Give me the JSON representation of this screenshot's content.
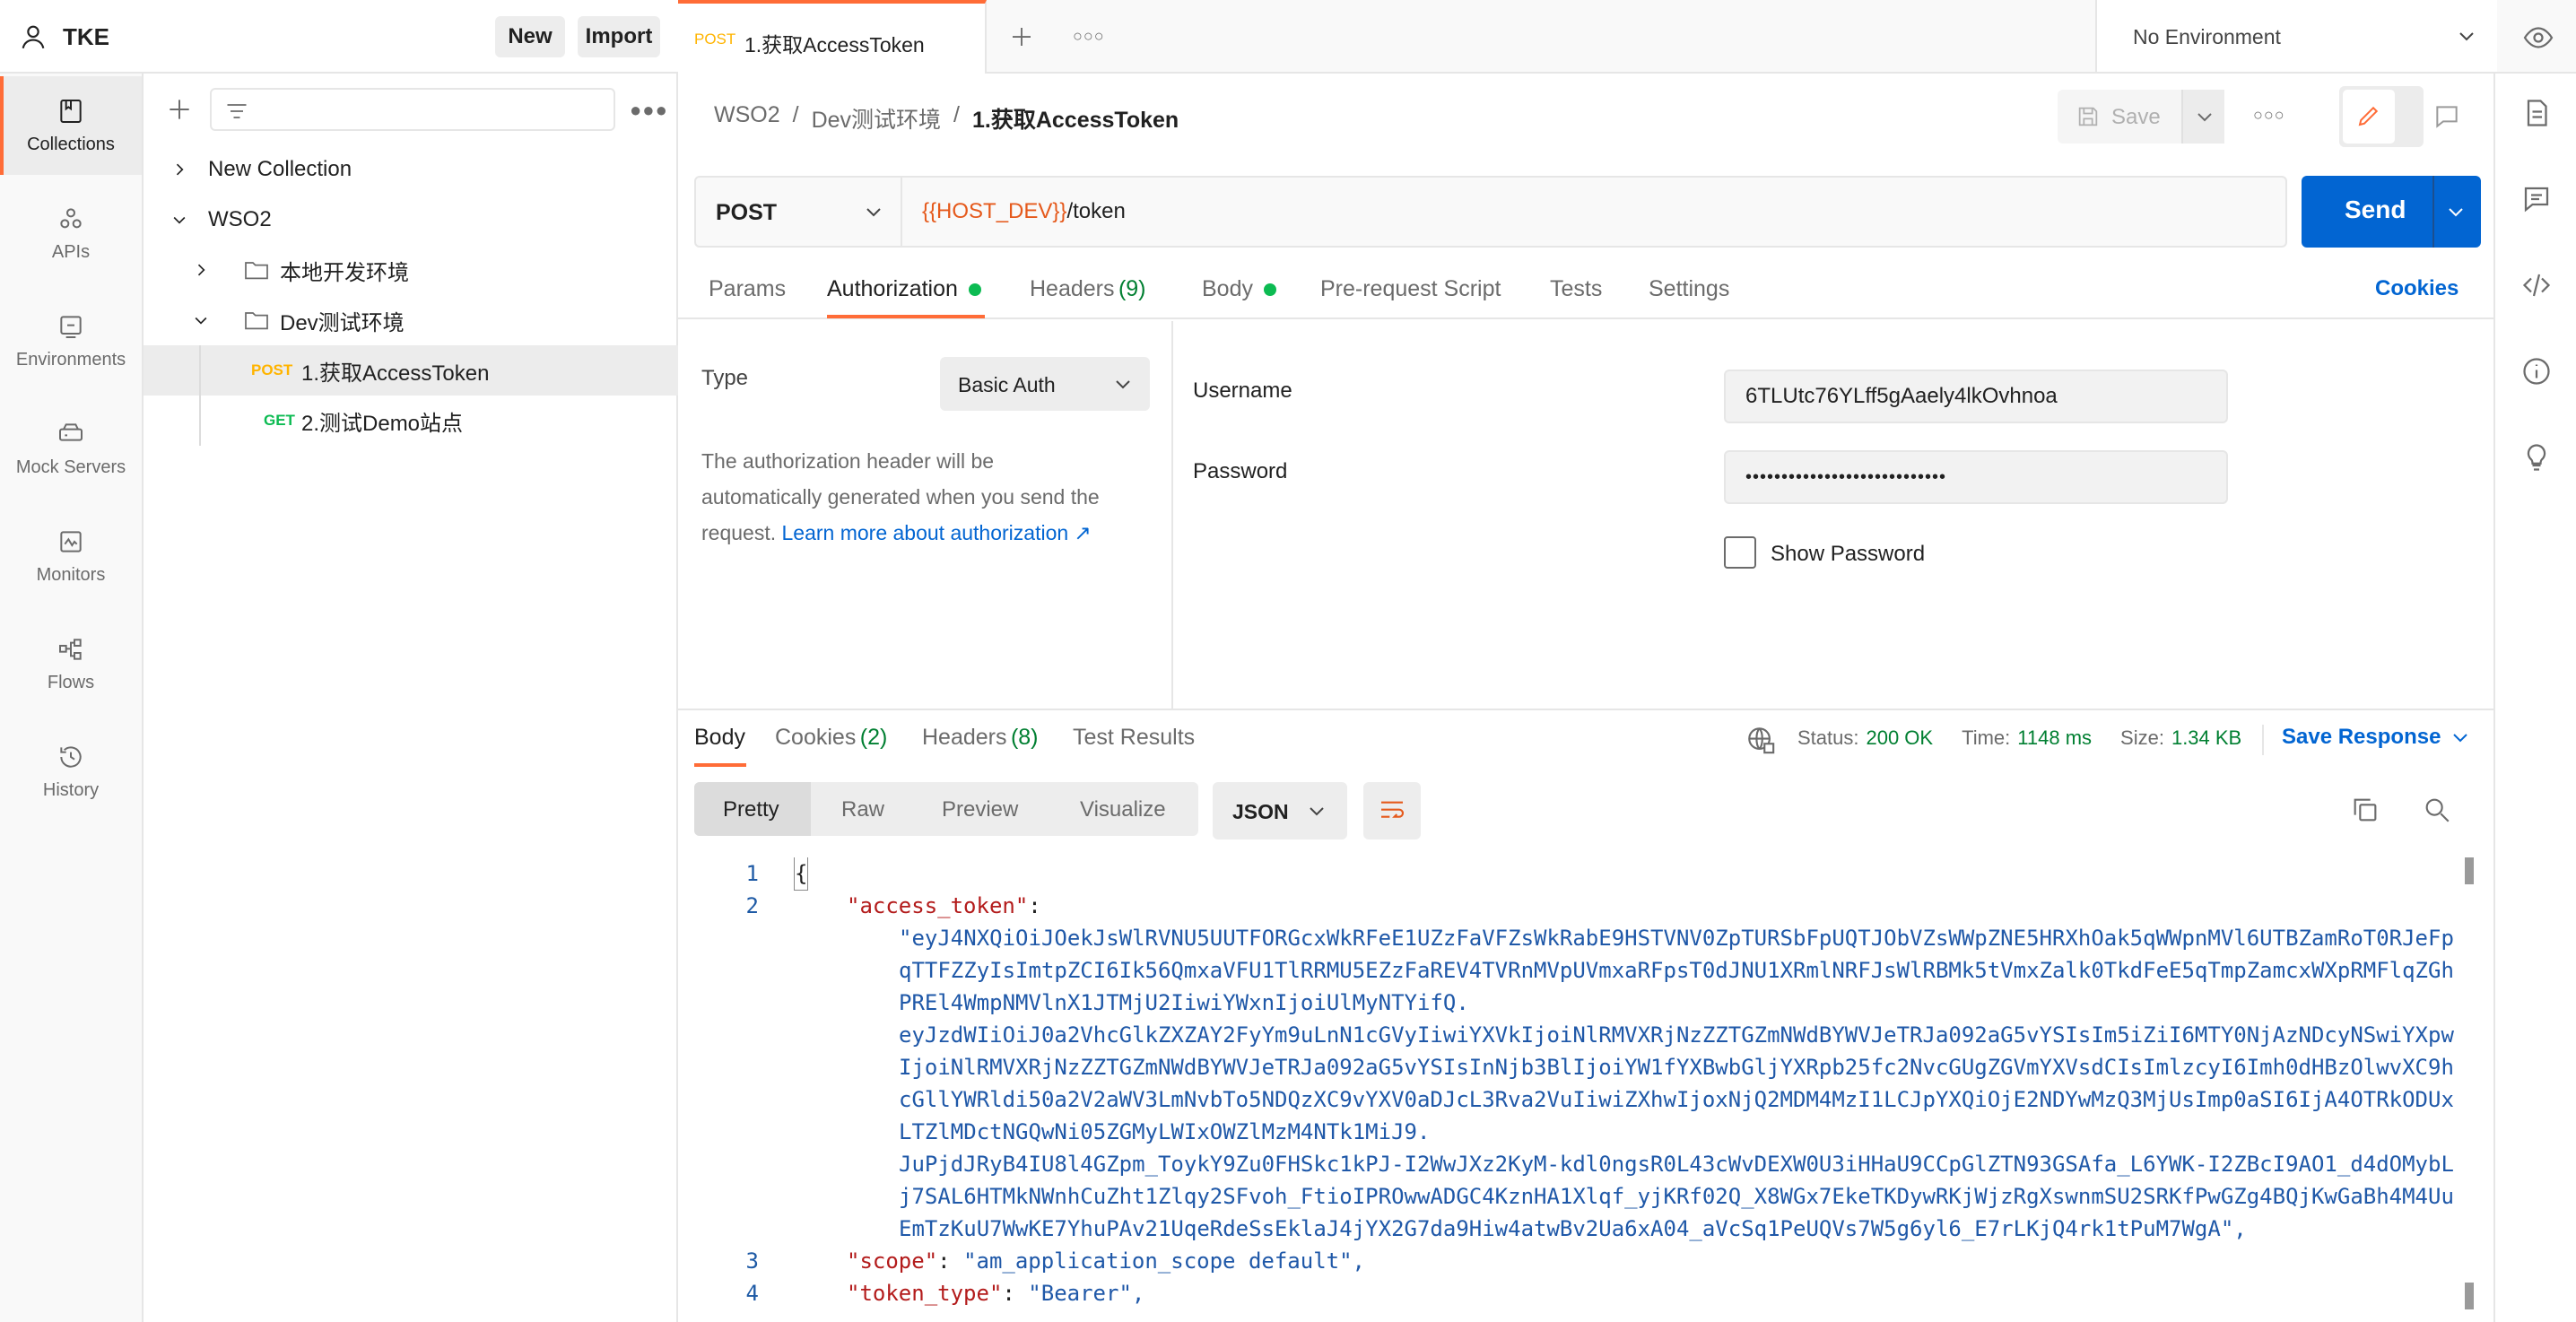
{
  "workspace": {
    "name": "TKE",
    "new_label": "New",
    "import_label": "Import"
  },
  "rail": [
    {
      "label": "Collections",
      "icon": "collections-icon",
      "active": true
    },
    {
      "label": "APIs",
      "icon": "apis-icon"
    },
    {
      "label": "Environments",
      "icon": "environments-icon"
    },
    {
      "label": "Mock Servers",
      "icon": "mock-servers-icon"
    },
    {
      "label": "Monitors",
      "icon": "monitors-icon"
    },
    {
      "label": "Flows",
      "icon": "flows-icon"
    },
    {
      "label": "History",
      "icon": "history-icon"
    }
  ],
  "tree": {
    "new_collection": "New Collection",
    "wso2": "WSO2",
    "local_folder": "本地开发环境",
    "dev_folder": "Dev测试环境",
    "req1": {
      "method": "POST",
      "name": "1.获取AccessToken"
    },
    "req2": {
      "method": "GET",
      "name": "2.测试Demo站点"
    }
  },
  "tab": {
    "method": "POST",
    "name": "1.获取AccessToken"
  },
  "environment": "No Environment",
  "breadcrumb": {
    "part1": "WSO2",
    "sep": "/",
    "part2": "Dev测试环境",
    "current": "1.获取AccessToken"
  },
  "save_label": "Save",
  "request": {
    "method": "POST",
    "url_var": "{{HOST_DEV}}",
    "url_path": "/token",
    "send_label": "Send"
  },
  "req_tabs": {
    "params": "Params",
    "authorization": "Authorization",
    "headers": "Headers",
    "headers_count": "(9)",
    "body": "Body",
    "prerequest": "Pre-request Script",
    "tests": "Tests",
    "settings": "Settings",
    "cookies": "Cookies"
  },
  "auth": {
    "type_label": "Type",
    "type_value": "Basic Auth",
    "desc_line1": "The authorization header will be",
    "desc_line2": "automatically generated when you send the",
    "desc_line3": "request.",
    "learn_more": "Learn more about authorization ↗",
    "username_label": "Username",
    "username_value": "6TLUtc76YLff5gAaely4lkOvhnoa",
    "password_label": "Password",
    "password_value": "••••••••••••••••••••••••••••",
    "show_password": "Show Password"
  },
  "response": {
    "body_tab": "Body",
    "cookies_tab": "Cookies",
    "cookies_count": "(2)",
    "headers_tab": "Headers",
    "headers_count": "(8)",
    "test_results_tab": "Test Results",
    "status_label": "Status:",
    "status_value": "200 OK",
    "time_label": "Time:",
    "time_value": "1148 ms",
    "size_label": "Size:",
    "size_value": "1.34 KB",
    "save_response": "Save Response",
    "view_tabs": {
      "pretty": "Pretty",
      "raw": "Raw",
      "preview": "Preview",
      "visualize": "Visualize"
    },
    "format": "JSON"
  },
  "code": {
    "line_numbers": [
      "1",
      "2",
      "3",
      "4"
    ],
    "open_brace": "{",
    "access_token_key": "\"access_token\"",
    "colon": ":",
    "token_lines": [
      "\"eyJ4NXQiOiJOekJsWlRVNU5UUTFORGcxWkRFeE1UZzFaVFZsWkRabE9HSTVNV0ZpTURSbFpUQTJObVZsWWpZNE5HRXhOak5qWWpnMVl6UTBZamRoT0RJeFp",
      "qTTFZZyIsImtpZCI6Ik56QmxaVFU1TlRRMU5EZzFaREV4TVRnMVpUVmxaRFpsT0dJNU1XRmlNRFJsWlRBMk5tVmxZalk0TkdFeE5qTmpZamcxWXpRMFlqZGh",
      "PREl4WmpNMVlnX1JTMjU2IiwiYWxnIjoiUlMyNTYifQ.",
      "eyJzdWIiOiJ0a2VhcGlkZXZAY2FyYm9uLnN1cGVyIiwiYXVkIjoiNlRMVXRjNzZZTGZmNWdBYWVJeTRJa092aG5vYSIsIm5iZiI6MTY0NjAzNDcyNSwiYXpw",
      "IjoiNlRMVXRjNzZZTGZmNWdBYWVJeTRJa092aG5vYSIsInNjb3BlIjoiYW1fYXBwbGljYXRpb25fc2NvcGUgZGVmYXVsdCIsImlzcyI6Imh0dHBzOlwvXC9h",
      "cGllYWRldi50a2V2aWV3LmNvbTo5NDQzXC9vYXV0aDJcL3Rva2VuIiwiZXhwIjoxNjQ2MDM4MzI1LCJpYXQiOjE2NDYwMzQ3MjUsImp0aSI6IjA4OTRkODUx",
      "LTZlMDctNGQwNi05ZGMyLWIxOWZlMzM4NTk1MiJ9.",
      "JuPjdJRyB4IU8l4GZpm_ToykY9Zu0FHSkc1kPJ-I2WwJXz2KyM-kdl0ngsR0L43cWvDEXW0U3iHHaU9CCpGlZTN93GSAfa_L6YWK-I2ZBcI9AO1_d4dOMybL",
      "j7SAL6HTMkNWnhCuZht1Zlqy2SFvoh_FtioIPROwwADGC4KznHA1Xlqf_yjKRf02Q_X8WGx7EkeTKDywRKjWjzRgXswnmSU2SRKfPwGZg4BQjKwGaBh4M4Uu",
      "EmTzKuU7WwKE7YhuPAv21UqeRdeSsEklaJ4jYX2G7da9Hiw4atwBv2Ua6xA04_aVcSq1PeUQVs7W5g6yl6_E7rLKjQ4rk1tPuM7WgA\","
    ],
    "scope_key": "\"scope\"",
    "scope_value": "\"am_application_scope default\",",
    "token_type_key": "\"token_type\"",
    "token_type_value": "\"Bearer\","
  },
  "colors": {
    "accent": "#ff6c37",
    "send": "#0265d2",
    "link": "#0265d2",
    "ok": "#007f31",
    "dot": "#0cbb52",
    "var": "#e5591b"
  }
}
